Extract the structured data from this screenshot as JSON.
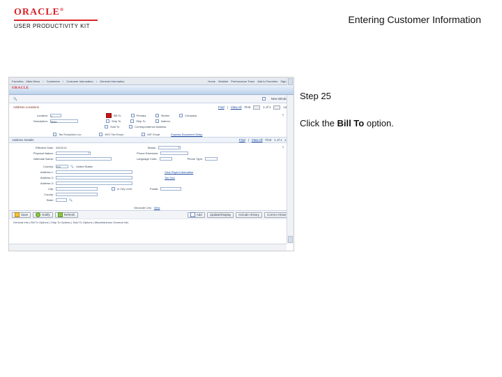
{
  "logo": {
    "brand": "ORACLE",
    "sub": "USER PRODUCTIVITY KIT"
  },
  "page_title": "Entering Customer Information",
  "rhs": {
    "step": "Step 25",
    "instr_prefix": "Click the ",
    "instr_bold": "Bill To",
    "instr_suffix": " option."
  },
  "tabs": {
    "left": [
      "Favorites",
      "Main Menu",
      "Customers",
      "Customer Information",
      "General Information"
    ],
    "right": [
      "Home",
      "Worklist",
      "Performance Trace",
      "Add to Favorites",
      "Sign out"
    ]
  },
  "inner_brand": "ORACLE",
  "secbar": {
    "left_blank": "",
    "new_window": "New Window"
  },
  "locrow": {
    "label": "Address Locations",
    "find": "Find",
    "viewall": "View All",
    "first": "First",
    "counter": "1 of 1",
    "last": "Last"
  },
  "form": {
    "location_lbl": "Location:",
    "location_val": "1",
    "description_lbl": "Description:",
    "description_val": "Main",
    "checks": {
      "billto": "Bill To",
      "shipto": "Ship To",
      "soldto": "Sold To",
      "primary": "Primary",
      "ship": "Ship To",
      "indirect": "Indirect",
      "correspond": "Correspondence Address",
      "company": "Company",
      "broker": "Broker"
    },
    "taxloc_lbl": "Tax Exception Loc",
    "wbtax_lbl": "W/O Tax Excpt",
    "vat_lbl": "VAT Excpt",
    "express_lbl": "Express Document Setup"
  },
  "addr": {
    "section": "Address Details",
    "find": "Find",
    "viewall": "View All",
    "first": "First",
    "counter": "1 of 1",
    "last": "Last",
    "effdate_lbl": "Effective Date:",
    "effdate_val": "04/02/14",
    "status_lbl": "Status:",
    "physical_lbl": "Physical Nature:",
    "alt_lbl": "Alternate Name:",
    "lang_lbl": "Language Code:",
    "phone_ext_lbl": "Phone Extension:",
    "phonetype_lbl": "Phone Type:",
    "country_lbl": "Country:",
    "country_val": "USA",
    "country_name": "United States",
    "addr1_lbl": "Address 1:",
    "addr2_lbl": "Address 2:",
    "addr3_lbl": "Address 3:",
    "city_lbl": "City:",
    "county_lbl": "County:",
    "state_lbl": "State:",
    "inlimit_lbl": "In City Limit",
    "postal_lbl": "Postal:",
    "taxinfo": "View Payer Information",
    "taxgeo": "Tax Geo",
    "geocode_lbl": "Geocode Link:",
    "geocode_val": "View"
  },
  "bar1": {
    "save": "Save",
    "notify": "Notify",
    "refresh": "Refresh",
    "add": "Add",
    "update": "Update/Display",
    "hist": "Include History",
    "corr": "Correct History"
  },
  "statusbar": {
    "text": "General Info | Bill To Options | Ship To Options | Sold To Options | Miscellaneous General Info"
  }
}
